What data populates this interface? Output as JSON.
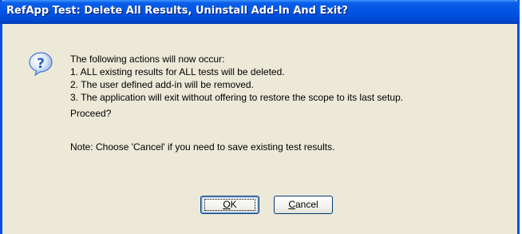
{
  "dialog": {
    "title": "RefApp Test: Delete All Results, Uninstall Add-In And Exit?",
    "icon": "question-icon",
    "message_lines": [
      "The following actions will now occur:",
      "1. ALL existing results for ALL tests will be deleted.",
      "2. The user defined add-in will be removed.",
      "3. The application will exit without offering to restore the scope to its last setup."
    ],
    "prompt": "Proceed?",
    "note": "Note: Choose 'Cancel' if you need to save existing test results."
  },
  "buttons": {
    "ok": {
      "mnemonic": "O",
      "rest": "K"
    },
    "cancel": {
      "mnemonic": "C",
      "rest": "ancel"
    }
  },
  "colors": {
    "titlebar": "#0054e3",
    "frame": "#0a4ee0",
    "dialog_bg": "#ece9d8",
    "icon_blue": "#2a63c9"
  }
}
